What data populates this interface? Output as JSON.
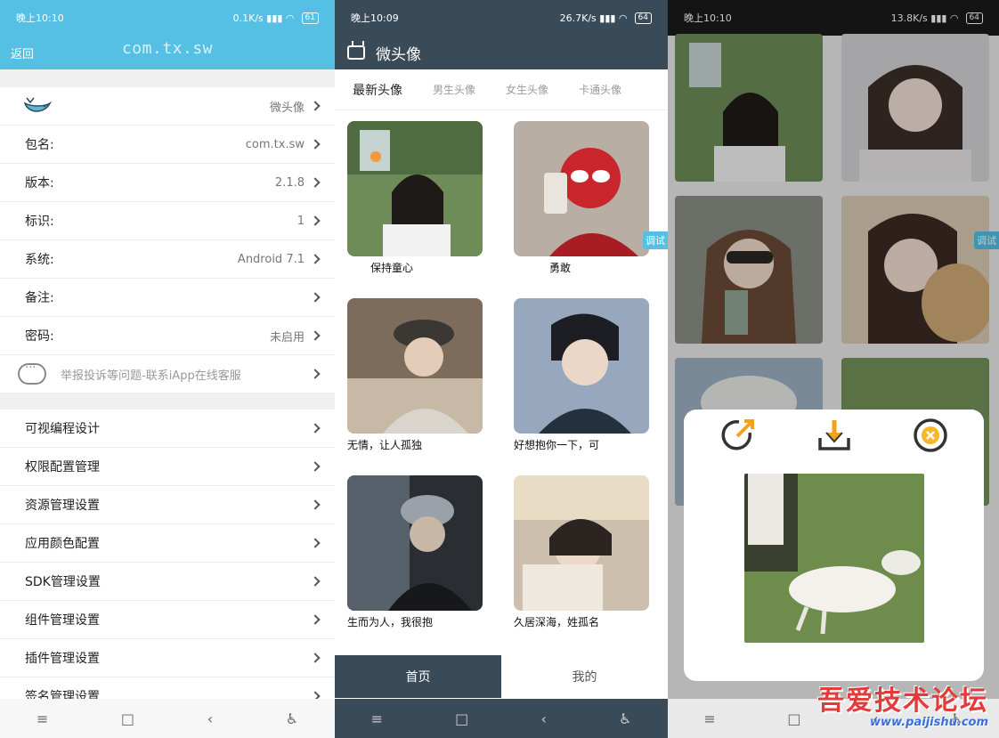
{
  "screen1": {
    "status": {
      "time": "晚上10:10",
      "net": "0.1K/s",
      "battery": "61"
    },
    "back_label": "返回",
    "title": "com.tx.sw",
    "rows": [
      {
        "label": "",
        "value": "微头像"
      },
      {
        "label": "包名:",
        "value": "com.tx.sw"
      },
      {
        "label": "版本:",
        "value": "2.1.8"
      },
      {
        "label": "标识:",
        "value": "1"
      },
      {
        "label": "系统:",
        "value": "Android 7.1"
      },
      {
        "label": "备注:",
        "value": ""
      },
      {
        "label": "密码:",
        "value": "未启用"
      },
      {
        "label": "举报投诉等问题-联系iApp在线客服",
        "value": ""
      }
    ],
    "settings": [
      "可视编程设计",
      "权限配置管理",
      "资源管理设置",
      "应用颜色配置",
      "SDK管理设置",
      "组件管理设置",
      "插件管理设置",
      "签名管理设置"
    ]
  },
  "screen2": {
    "status": {
      "time": "晚上10:09",
      "net": "26.7K/s",
      "battery": "64"
    },
    "title": "微头像",
    "tabs": [
      "最新头像",
      "男生头像",
      "女生头像",
      "卡通头像"
    ],
    "cards": [
      {
        "caption": "保持童心",
        "color": "#6f8f5a"
      },
      {
        "caption": "勇敢",
        "color": "#b5a79a"
      },
      {
        "caption": "无情，让人孤独",
        "color": "#8c7a66"
      },
      {
        "caption": "好想抱你一下，可",
        "color": "#8fa0b5"
      },
      {
        "caption": "生而为人，我很抱",
        "color": "#2b3036"
      },
      {
        "caption": "久居深海，姓孤名",
        "color": "#c9b8a6"
      }
    ],
    "debug_label": "调试",
    "bottom_tabs": {
      "home": "首页",
      "mine": "我的"
    }
  },
  "screen3": {
    "status": {
      "time": "晚上10:10",
      "net": "13.8K/s",
      "battery": "64"
    },
    "debug_label": "调试",
    "watermark": {
      "title": "吾爱技术论坛",
      "url": "www.paijishu.com"
    }
  }
}
